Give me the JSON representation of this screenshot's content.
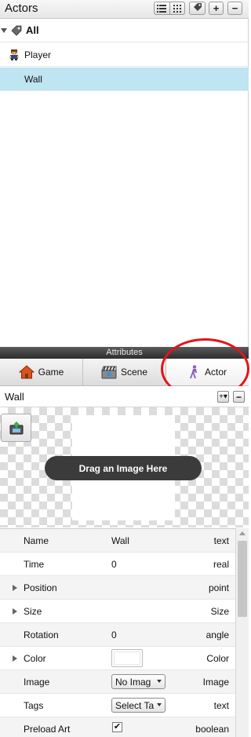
{
  "actors_panel": {
    "title": "Actors",
    "toolbar": {
      "list_view_icon": "list-view-icon",
      "grid_view_icon": "grid-view-icon",
      "tag_icon": "tag-icon",
      "add_label": "+",
      "remove_label": "−"
    },
    "tree": [
      {
        "label": "All",
        "icon": "tag-icon",
        "expanded": true,
        "selected": false
      },
      {
        "label": "Player",
        "icon": "player-sprite-icon",
        "selected": false
      },
      {
        "label": "Wall",
        "icon": "",
        "selected": true
      }
    ]
  },
  "attributes_panel": {
    "title": "Attributes",
    "tabs": [
      {
        "label": "Game",
        "icon": "house-icon",
        "active": false
      },
      {
        "label": "Scene",
        "icon": "clapperboard-icon",
        "active": false
      },
      {
        "label": "Actor",
        "icon": "walking-person-icon",
        "active": true
      }
    ],
    "selected_actor": "Wall",
    "drop_area": {
      "label": "Drag an Image Here"
    },
    "rows": [
      {
        "name": "Name",
        "value": "Wall",
        "type": "text"
      },
      {
        "name": "Time",
        "value": "0",
        "type": "real"
      },
      {
        "name": "Position",
        "value": "",
        "type": "point",
        "expandable": true
      },
      {
        "name": "Size",
        "value": "",
        "type": "Size",
        "expandable": true
      },
      {
        "name": "Rotation",
        "value": "0",
        "type": "angle"
      },
      {
        "name": "Color",
        "value": "",
        "type": "Color",
        "expandable": true
      },
      {
        "name": "Image",
        "value": "No Imag",
        "type": "Image",
        "control": "select"
      },
      {
        "name": "Tags",
        "value": "Select Ta",
        "type": "text",
        "control": "select"
      },
      {
        "name": "Preload Art",
        "value": "✔",
        "type": "boolean",
        "control": "checkbox",
        "checked": true
      }
    ]
  },
  "colors": {
    "selection": "#bfe4f2",
    "annotation": "#e0151c",
    "header_dark": "#3b3b3b"
  }
}
